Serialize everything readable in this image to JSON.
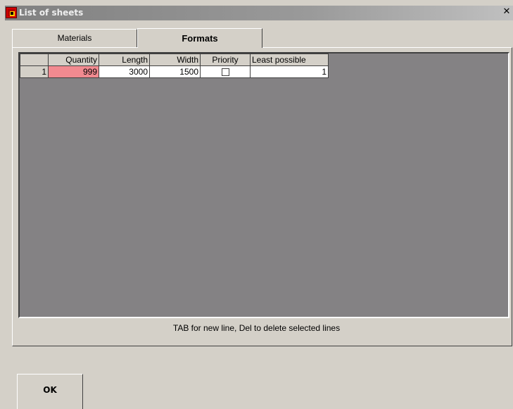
{
  "window": {
    "title": "List of sheets",
    "close_glyph": "✕"
  },
  "tabs": [
    {
      "label": "Materials",
      "selected": false
    },
    {
      "label": "Formats",
      "selected": true
    }
  ],
  "grid": {
    "columns": [
      "Quantity",
      "Length",
      "Width",
      "Priority",
      "Least possible"
    ],
    "rows": [
      {
        "row_number": "1",
        "quantity": "999",
        "length": "3000",
        "width": "1500",
        "priority": false,
        "least_possible": "1"
      }
    ]
  },
  "status": "TAB for new line, Del to delete selected lines",
  "buttons": {
    "ok": "OK"
  },
  "colors": {
    "selected_cell": "#f28a90",
    "grid_background": "#848284",
    "dialog_background": "#d4d0c8"
  }
}
